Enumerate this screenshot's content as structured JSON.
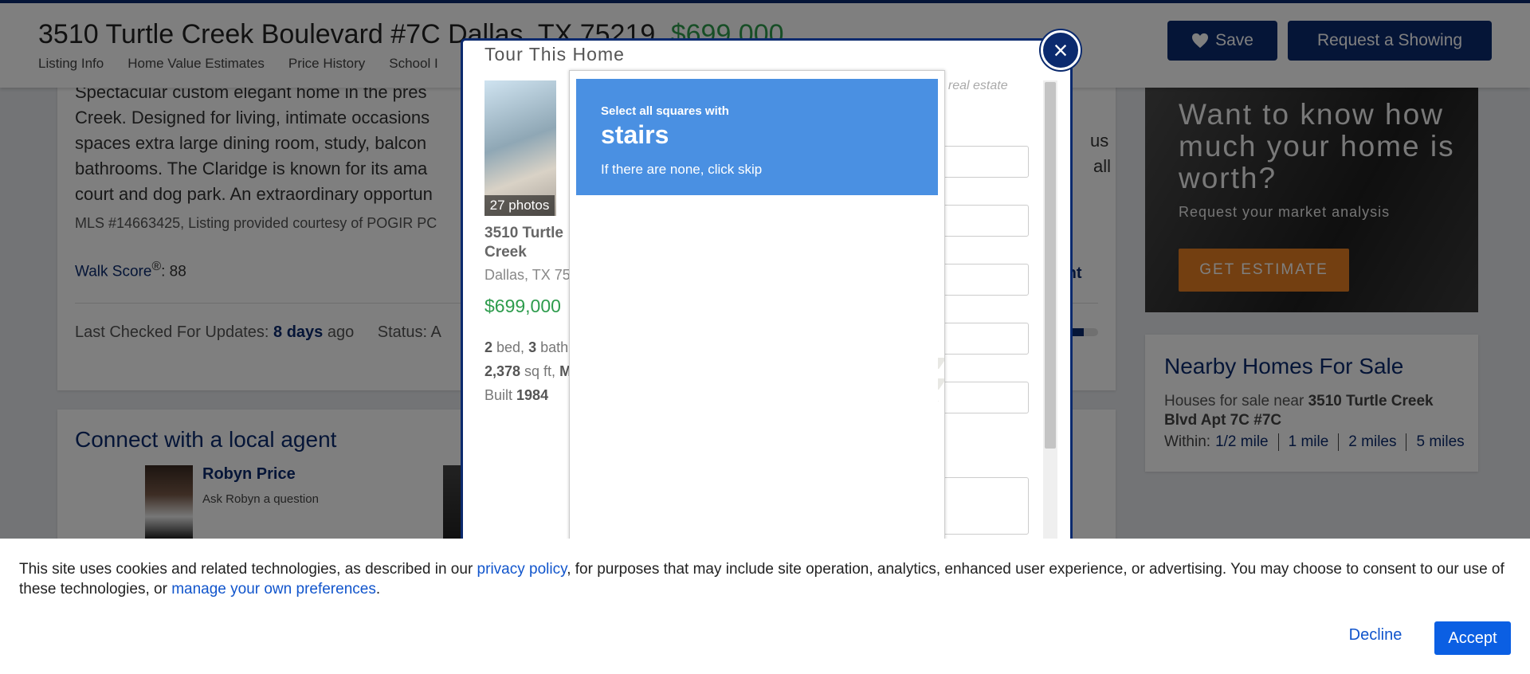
{
  "listing": {
    "address": "3510 Turtle Creek Boulevard #7C Dallas, TX 75219",
    "price": "$699,000",
    "nav": [
      "Listing Info",
      "Home Value Estimates",
      "Price History",
      "School I"
    ],
    "save_label": "Save",
    "request_label": "Request a Showing"
  },
  "description": {
    "lines": [
      "Spectacular custom elegant home in the pres",
      "Creek. Designed for living, intimate occasions",
      "spaces extra large dining room, study, balcon",
      "bathrooms. The Claridge is known for its ama",
      "court and dog park. An extraordinary opportun"
    ],
    "right_fragments": [
      "us",
      "all"
    ],
    "mls": "MLS #14663425, Listing provided courtesy of POGIR PC",
    "walk_label": "Walk Score",
    "walk_sup": "®",
    "walk_value": ": 88",
    "print_label": "Print",
    "checked_label": "Last Checked For Updates: ",
    "checked_value": "8 days",
    "checked_suffix": " ago",
    "status_label": "Status: A",
    "progress_fraction": 0.6
  },
  "agent_section": {
    "title": "Connect with a local agent",
    "agent_name": "Robyn Price",
    "agent_ask": "Ask Robyn a question",
    "next_glyph": "›"
  },
  "ad": {
    "headline": "Want to know how much your home is worth?",
    "sub": "Request your market analysis",
    "button": "GET ESTIMATE"
  },
  "nearby": {
    "title": "Nearby Homes For Sale",
    "text_prefix": "Houses for sale near ",
    "text_bold": "3510 Turtle Creek Blvd Apt 7C #7C",
    "within_label": "Within:",
    "distances": [
      "1/2 mile",
      "1 mile",
      "2 miles",
      "5 miles"
    ]
  },
  "modal": {
    "title": "Tour This Home",
    "photos_badge": "27 photos",
    "name": "3510 Turtle Creek Boulevard",
    "city": "Dallas, TX 75219",
    "price": "$699,000",
    "beds": "2",
    "beds_label": " bed, ",
    "baths": "3",
    "baths_label": " bath",
    "sqft": "2,378",
    "sqft_label": " sq ft, ",
    "sqft_tail": "M",
    "built_label": "Built ",
    "built": "1984",
    "hint": "al real estate",
    "close_glyph": "×"
  },
  "captcha": {
    "instruction": "Select all squares with",
    "target": "stairs",
    "skip_hint": "If there are none, click skip"
  },
  "cookie": {
    "text1": "This site uses cookies and related technologies, as described in our ",
    "link1": "privacy policy",
    "text2": ", for purposes that may include site operation, analytics, enhanced user experience, or advertising. You may choose to consent to our use of these technologies, or ",
    "link2": "manage your own preferences",
    "text3": ".",
    "decline": "Decline",
    "accept": "Accept"
  },
  "colors": {
    "brand_navy": "#0b2a6e",
    "price_green": "#2e9c4d",
    "captcha_blue": "#4a90e2",
    "accept_blue": "#0b5fe3",
    "ad_orange": "#e67e22"
  },
  "icons": [
    "heart-icon",
    "close-icon",
    "chevron-right-icon"
  ]
}
